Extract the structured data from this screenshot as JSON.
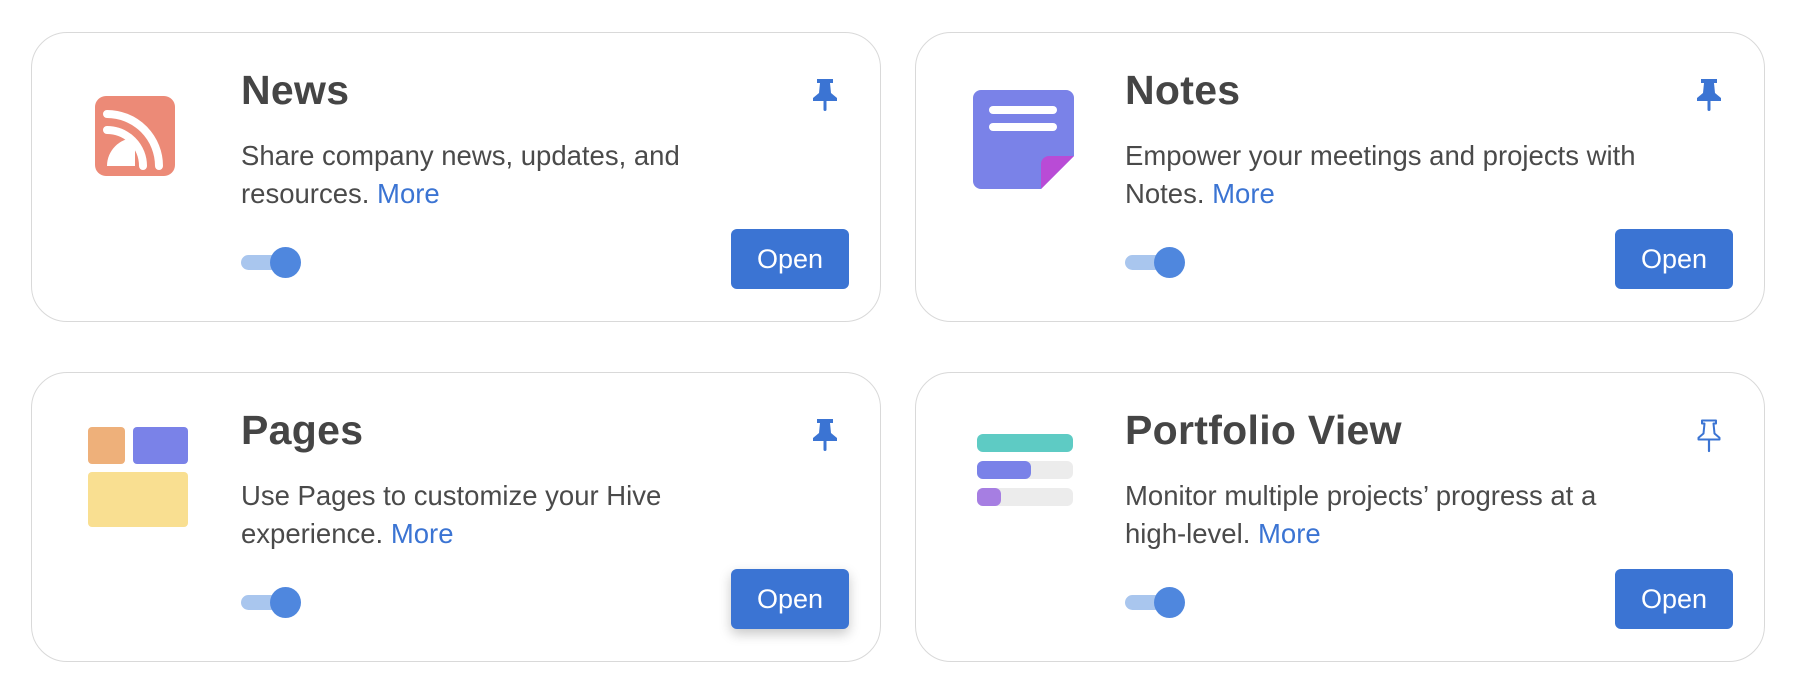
{
  "colors": {
    "accent": "#3b74d3",
    "toggle_track": "#a9c6ee",
    "toggle_knob": "#4f87de",
    "card_border": "#d9d9d9",
    "news_icon": "#ec8a77",
    "notes_icon": "#7a82e8",
    "notes_corner": "#b94bd6",
    "pages_orange": "#eeb07a",
    "pages_blue": "#7a82e8",
    "pages_yellow": "#f9df91",
    "portfolio_teal": "#5ecbc4",
    "portfolio_blue": "#7a82e8",
    "portfolio_purple": "#a67ee2",
    "portfolio_bg": "#ececec"
  },
  "cards": [
    {
      "id": "news",
      "icon": "rss-icon",
      "title": "News",
      "description": "Share company news, updates, and resources.",
      "more_label": "More",
      "pinned": true,
      "enabled": true,
      "open_label": "Open"
    },
    {
      "id": "notes",
      "icon": "notes-icon",
      "title": "Notes",
      "description": "Empower your meetings and projects with Notes.",
      "more_label": "More",
      "pinned": true,
      "enabled": true,
      "open_label": "Open"
    },
    {
      "id": "pages",
      "icon": "pages-layout-icon",
      "title": "Pages",
      "description": "Use Pages to customize your Hive experience.",
      "more_label": "More",
      "pinned": true,
      "enabled": true,
      "open_label": "Open"
    },
    {
      "id": "portfolio",
      "icon": "portfolio-progress-icon",
      "title": "Portfolio View",
      "description": "Monitor multiple projects’ progress at a high-level.",
      "more_label": "More",
      "pinned": false,
      "enabled": true,
      "open_label": "Open"
    }
  ]
}
